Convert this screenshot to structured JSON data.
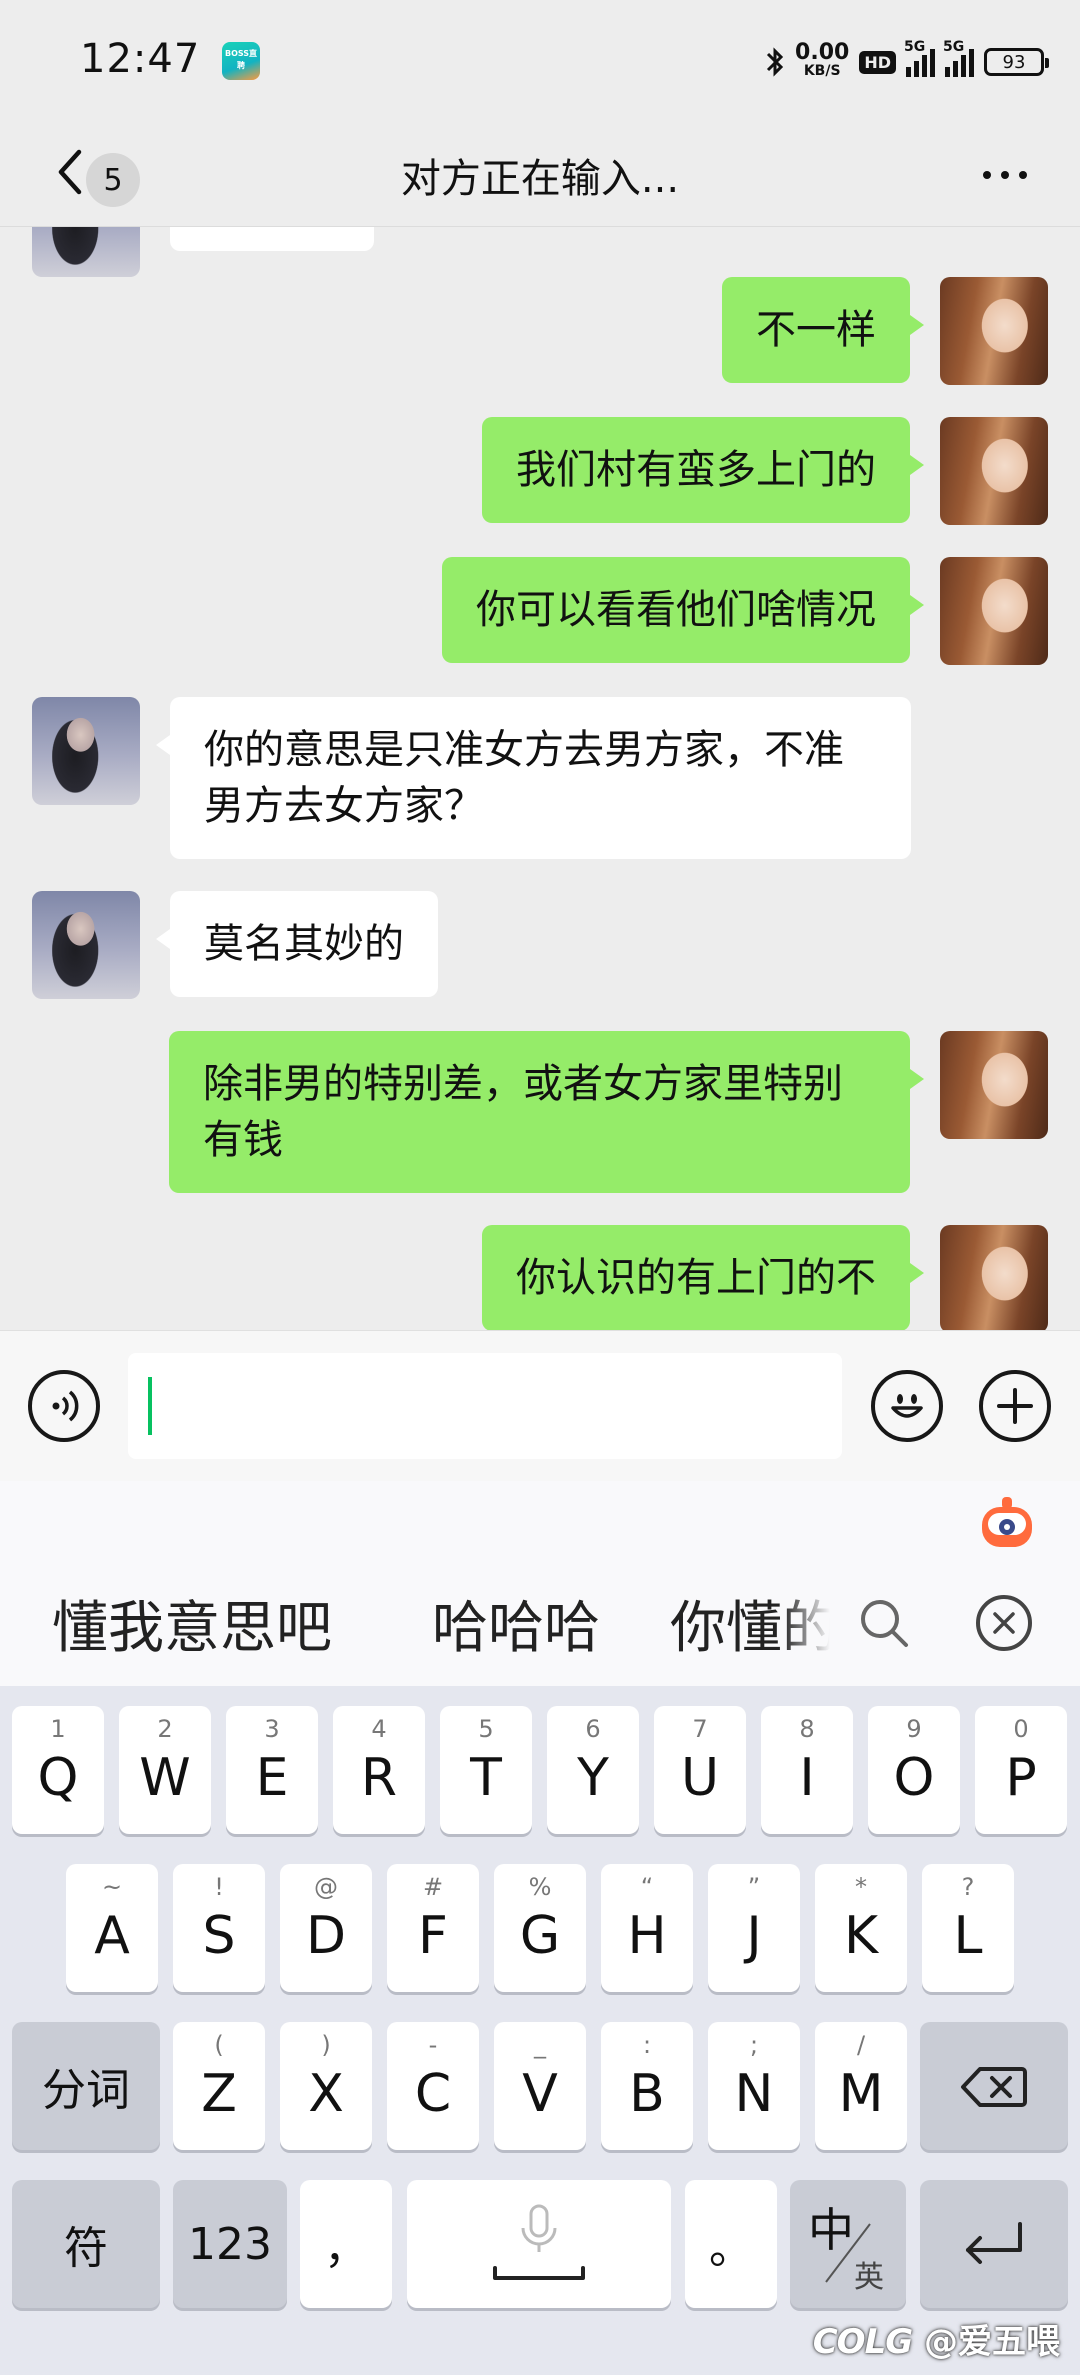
{
  "status_bar": {
    "time": "12:47",
    "app_icon_text": "BOSS直聘",
    "net_speed_value": "0.00",
    "net_speed_unit": "KB/S",
    "hd_label": "HD",
    "sim1_label": "5G",
    "sim2_label": "5G",
    "battery": "93"
  },
  "nav": {
    "unread_count": "5",
    "title": "对方正在输入..."
  },
  "messages": [
    {
      "from": "me",
      "text": "不一样"
    },
    {
      "from": "me",
      "text": "我们村有蛮多上门的"
    },
    {
      "from": "me",
      "text": "你可以看看他们啥情况"
    },
    {
      "from": "her",
      "text": "你的意思是只准女方去男方家，不准男方去女方家？"
    },
    {
      "from": "her",
      "text": "莫名其妙的"
    },
    {
      "from": "me",
      "text": "除非男的特别差，或者女方家里特别有钱"
    },
    {
      "from": "me",
      "text": "你认识的有上门的不"
    }
  ],
  "input": {
    "value": "",
    "placeholder": ""
  },
  "keyboard": {
    "candidates": [
      "懂我意思吧",
      "哈哈哈",
      "你懂的"
    ],
    "row1": [
      {
        "hint": "1",
        "key": "Q"
      },
      {
        "hint": "2",
        "key": "W"
      },
      {
        "hint": "3",
        "key": "E"
      },
      {
        "hint": "4",
        "key": "R"
      },
      {
        "hint": "5",
        "key": "T"
      },
      {
        "hint": "6",
        "key": "Y"
      },
      {
        "hint": "7",
        "key": "U"
      },
      {
        "hint": "8",
        "key": "I"
      },
      {
        "hint": "9",
        "key": "O"
      },
      {
        "hint": "0",
        "key": "P"
      }
    ],
    "row2": [
      {
        "hint": "~",
        "key": "A"
      },
      {
        "hint": "!",
        "key": "S"
      },
      {
        "hint": "@",
        "key": "D"
      },
      {
        "hint": "#",
        "key": "F"
      },
      {
        "hint": "%",
        "key": "G"
      },
      {
        "hint": "“",
        "key": "H"
      },
      {
        "hint": "”",
        "key": "J"
      },
      {
        "hint": "*",
        "key": "K"
      },
      {
        "hint": "?",
        "key": "L"
      }
    ],
    "row3": [
      {
        "hint": "(",
        "key": "Z"
      },
      {
        "hint": ")",
        "key": "X"
      },
      {
        "hint": "-",
        "key": "C"
      },
      {
        "hint": "_",
        "key": "V"
      },
      {
        "hint": ":",
        "key": "B"
      },
      {
        "hint": ";",
        "key": "N"
      },
      {
        "hint": "/",
        "key": "M"
      }
    ],
    "segment_key": "分词",
    "symbol_key": "符",
    "number_key": "123",
    "comma_key": "，",
    "period_key": "。",
    "lang_main": "中",
    "lang_sub": "英"
  },
  "watermark": "@爱五喂"
}
